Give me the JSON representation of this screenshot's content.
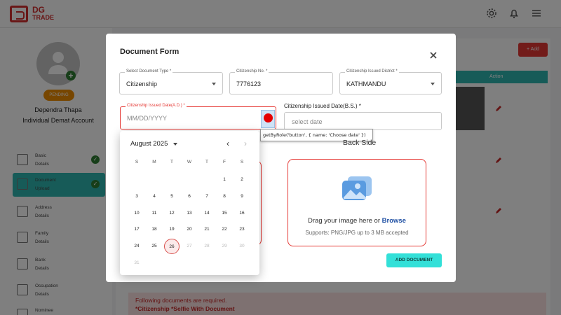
{
  "app": {
    "logo_line1": "DG",
    "logo_line2": "TRADE",
    "add_button": "+ Add",
    "table_header_action": "Action",
    "requirement_note": "Following documents are required.",
    "required_docs": "*Citizenship  *Selfie With Document"
  },
  "profile": {
    "status": "PENDING",
    "name": "Dependra Thapa",
    "account_type": "Individual Demat Account"
  },
  "sidebar": {
    "items": [
      {
        "label1": "Basic",
        "label2": "Details",
        "done": true,
        "active": false,
        "icon": "user-edit-icon"
      },
      {
        "label1": "Document",
        "label2": "Upload",
        "done": true,
        "active": true,
        "icon": "document-icon"
      },
      {
        "label1": "Address",
        "label2": "Details",
        "done": false,
        "active": false,
        "icon": "location-icon"
      },
      {
        "label1": "Family",
        "label2": "Details",
        "done": false,
        "active": false,
        "icon": "family-icon"
      },
      {
        "label1": "Bank",
        "label2": "Details",
        "done": false,
        "active": false,
        "icon": "bank-icon"
      },
      {
        "label1": "Occupation",
        "label2": "Details",
        "done": false,
        "active": false,
        "icon": "briefcase-icon"
      },
      {
        "label1": "Nominee",
        "label2": "",
        "done": false,
        "active": false,
        "icon": "nominee-icon"
      }
    ]
  },
  "modal": {
    "title": "Document Form",
    "doc_type": {
      "label": "Select Document Type *",
      "value": "Citizenship"
    },
    "citizenship_no": {
      "label": "Citizenship No. *",
      "value": "7776123"
    },
    "district": {
      "label": "Citizenship Issued District *",
      "value": "KATHMANDU"
    },
    "issued_ad": {
      "label": "Citizenship Issued Date(A.D.) *",
      "placeholder": "MM/DD/YYYY"
    },
    "issued_bs": {
      "label": "Citizenship Issued Date(B.S.) *",
      "placeholder": "select date"
    },
    "tooltip": "getByRole('button', { name: 'Choose date' })",
    "back_side_title": "Back Side",
    "dropzone_text": "Drag your image here or ",
    "dropzone_browse": "Browse",
    "dropzone_sub": "Supports: PNG/JPG up to 3 MB accepted",
    "add_document": "ADD DOCUMENT"
  },
  "calendar": {
    "month_label": "August 2025",
    "weekdays": [
      "S",
      "M",
      "T",
      "W",
      "T",
      "F",
      "S"
    ],
    "weeks": [
      [
        "",
        "",
        "",
        "",
        "",
        "1",
        "2"
      ],
      [
        "3",
        "4",
        "5",
        "6",
        "7",
        "8",
        "9"
      ],
      [
        "10",
        "11",
        "12",
        "13",
        "14",
        "15",
        "16"
      ],
      [
        "17",
        "18",
        "19",
        "20",
        "21",
        "22",
        "23"
      ],
      [
        "24",
        "25",
        "26",
        "27",
        "28",
        "29",
        "30"
      ],
      [
        "31",
        "",
        "",
        "",
        "",
        "",
        ""
      ]
    ],
    "today": "26",
    "future_days": [
      "27",
      "28",
      "29",
      "30",
      "31"
    ]
  },
  "colors": {
    "accent": "#2fb7b0",
    "error": "#e53935",
    "brand": "#d32f2f"
  }
}
